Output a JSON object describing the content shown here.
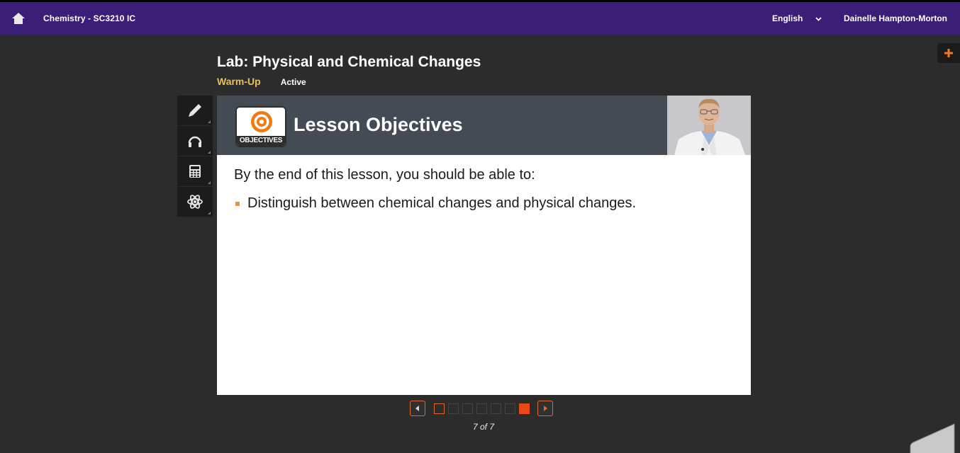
{
  "topbar": {
    "course_title": "Chemistry - SC3210 IC",
    "language": "English",
    "user_name": "Dainelle Hampton-Morton"
  },
  "lesson": {
    "title": "Lab: Physical and Chemical Changes",
    "section": "Warm-Up",
    "status": "Active"
  },
  "tools": [
    {
      "name": "pencil-icon"
    },
    {
      "name": "headphones-icon"
    },
    {
      "name": "calculator-icon"
    },
    {
      "name": "atom-icon"
    }
  ],
  "slide": {
    "icon_label": "OBJECTIVES",
    "heading": "Lesson Objectives",
    "intro": "By the end of this lesson, you should be able to:",
    "bullets": [
      "Distinguish between chemical changes and physical changes."
    ]
  },
  "pager": {
    "total": 7,
    "current": 7,
    "label": "7 of 7"
  },
  "colors": {
    "topbar": "#3a1e78",
    "accent": "#e8491a",
    "section": "#e8c15a",
    "slide_header": "#454b55"
  }
}
